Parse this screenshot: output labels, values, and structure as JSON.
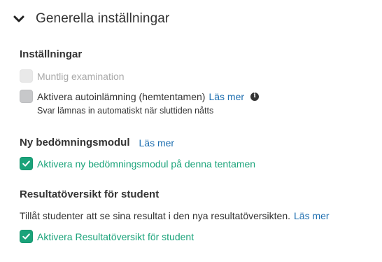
{
  "section": {
    "title": "Generella inställningar"
  },
  "settings": {
    "heading": "Inställningar",
    "oral_exam": {
      "label": "Muntlig examination",
      "checked": false,
      "disabled": true
    },
    "auto_submit": {
      "label": "Aktivera autoinlämning (hemtentamen)",
      "link": "Läs mer",
      "description": "Svar lämnas in automatiskt när sluttiden nåtts",
      "checked": false
    }
  },
  "grading_module": {
    "heading": "Ny bedömningsmodul",
    "link": "Läs mer",
    "checkbox_label": "Aktivera ny bedömningsmodul på denna tentamen",
    "checked": true
  },
  "result_overview": {
    "heading": "Resultatöversikt för student",
    "description": "Tillåt studenter att se sina resultat i den nya resultatöversikten.",
    "link": "Läs mer",
    "checkbox_label": "Aktivera Resultatöversikt för student",
    "checked": true
  },
  "colors": {
    "accent": "#1aa37a",
    "link": "#1f6fb0",
    "disabled": "#a9a9a9"
  },
  "icons": [
    "chevron-down-icon",
    "checkmark-icon",
    "info-icon"
  ]
}
